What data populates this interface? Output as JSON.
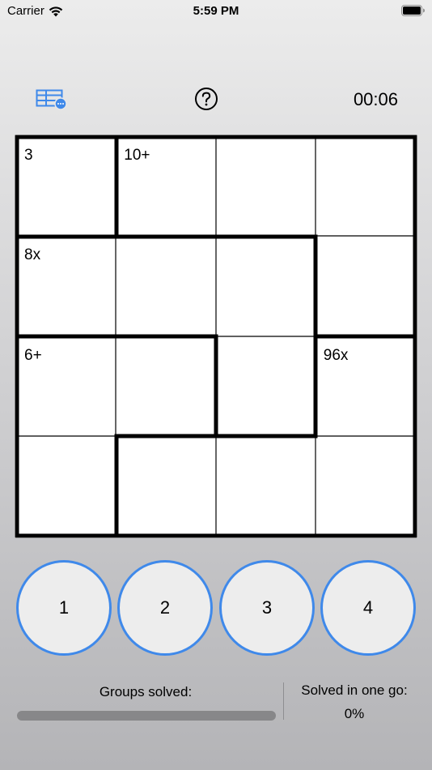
{
  "status_bar": {
    "carrier": "Carrier",
    "time": "5:59 PM"
  },
  "toolbar": {
    "menu_icon": "table-options-icon",
    "help_icon": "question-circle-icon",
    "timer": "00:06"
  },
  "board": {
    "size": 4,
    "cages": [
      {
        "label": "3",
        "row": 0,
        "col": 0
      },
      {
        "label": "10+",
        "row": 0,
        "col": 1
      },
      {
        "label": "8x",
        "row": 1,
        "col": 0
      },
      {
        "label": "6+",
        "row": 2,
        "col": 0
      },
      {
        "label": "96x",
        "row": 2,
        "col": 3
      }
    ],
    "cell_values": [
      [
        "",
        "",
        "",
        ""
      ],
      [
        "",
        "",
        "",
        ""
      ],
      [
        "",
        "",
        "",
        ""
      ],
      [
        "",
        "",
        "",
        ""
      ]
    ]
  },
  "numpad": {
    "buttons": [
      "1",
      "2",
      "3",
      "4"
    ]
  },
  "stats": {
    "groups_solved_label": "Groups solved:",
    "groups_solved_fraction": 0,
    "solved_in_one_go_label": "Solved in one go:",
    "solved_in_one_go_value": "0%"
  },
  "colors": {
    "accent": "#3f89ea",
    "progress_track": "#878789",
    "cell_background": "#ffffff"
  }
}
